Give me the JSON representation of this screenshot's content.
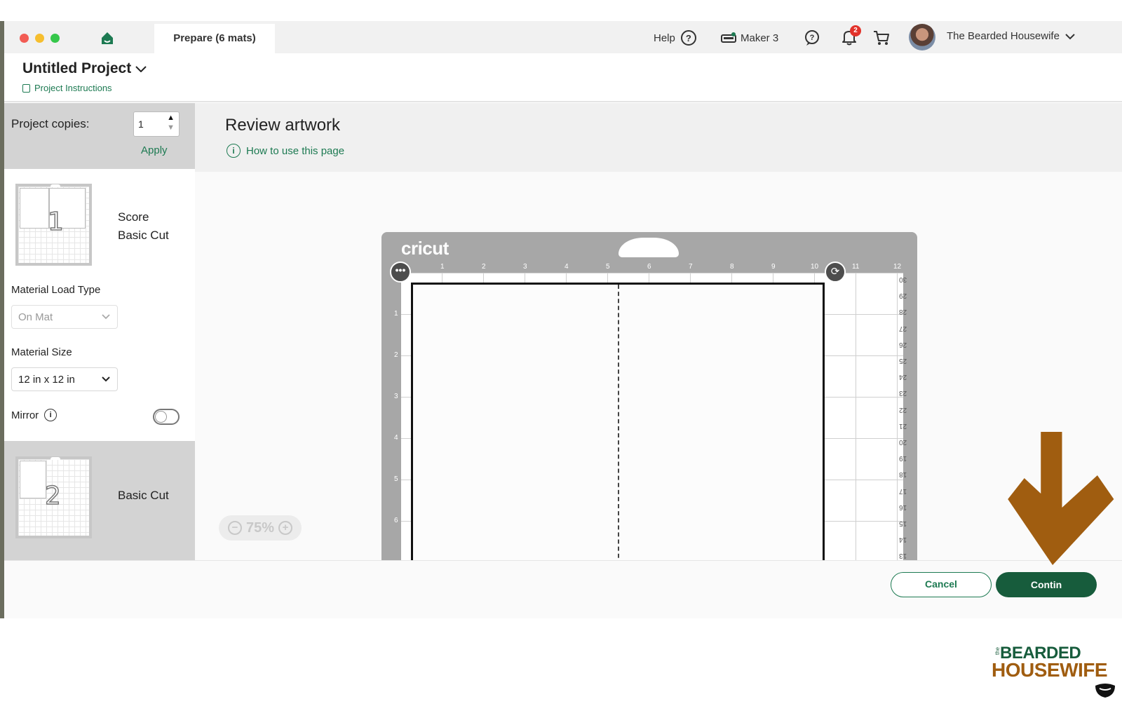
{
  "topbar": {
    "tab_label": "Prepare (6 mats)",
    "help_label": "Help",
    "help_icon": "?",
    "machine_label": "Maker 3",
    "notification_count": "2",
    "user_name": "The Bearded Housewife"
  },
  "header": {
    "project_title": "Untitled Project",
    "instructions_link": "Project Instructions"
  },
  "sidebar": {
    "copies_label": "Project copies:",
    "copies_value": "1",
    "apply_label": "Apply",
    "mats": [
      {
        "number": "1",
        "operations": [
          "Score",
          "Basic Cut"
        ]
      },
      {
        "number": "2",
        "operations": [
          "Basic Cut"
        ]
      }
    ],
    "material_load_type_label": "Material Load Type",
    "material_load_type_value": "On Mat",
    "material_size_label": "Material Size",
    "material_size_value": "12 in x 12 in",
    "mirror_label": "Mirror",
    "mirror_on": false
  },
  "main": {
    "review_title": "Review artwork",
    "howto_link": "How to use this page",
    "mat_brand": "cricut",
    "ruler_top": [
      "1",
      "2",
      "3",
      "4",
      "5",
      "6",
      "7",
      "8",
      "9",
      "10",
      "11",
      "12"
    ],
    "ruler_left": [
      "1",
      "2",
      "3",
      "4",
      "5",
      "6"
    ],
    "ruler_right": [
      "30",
      "29",
      "28",
      "27",
      "26",
      "25",
      "24",
      "23",
      "22",
      "21",
      "20",
      "19",
      "18",
      "17",
      "16",
      "15",
      "14",
      "13"
    ],
    "zoom_level": "75%"
  },
  "footer": {
    "cancel_label": "Cancel",
    "continue_label": "Contin"
  },
  "overlay": {
    "arrow_color": "#a05d10",
    "brand_the": "the",
    "brand_line1": "BEARDED",
    "brand_line2": "HOUSEWIFE"
  },
  "colors": {
    "accent_green": "#1d7a52",
    "primary_button": "#175c3c",
    "badge_red": "#e2322a"
  }
}
